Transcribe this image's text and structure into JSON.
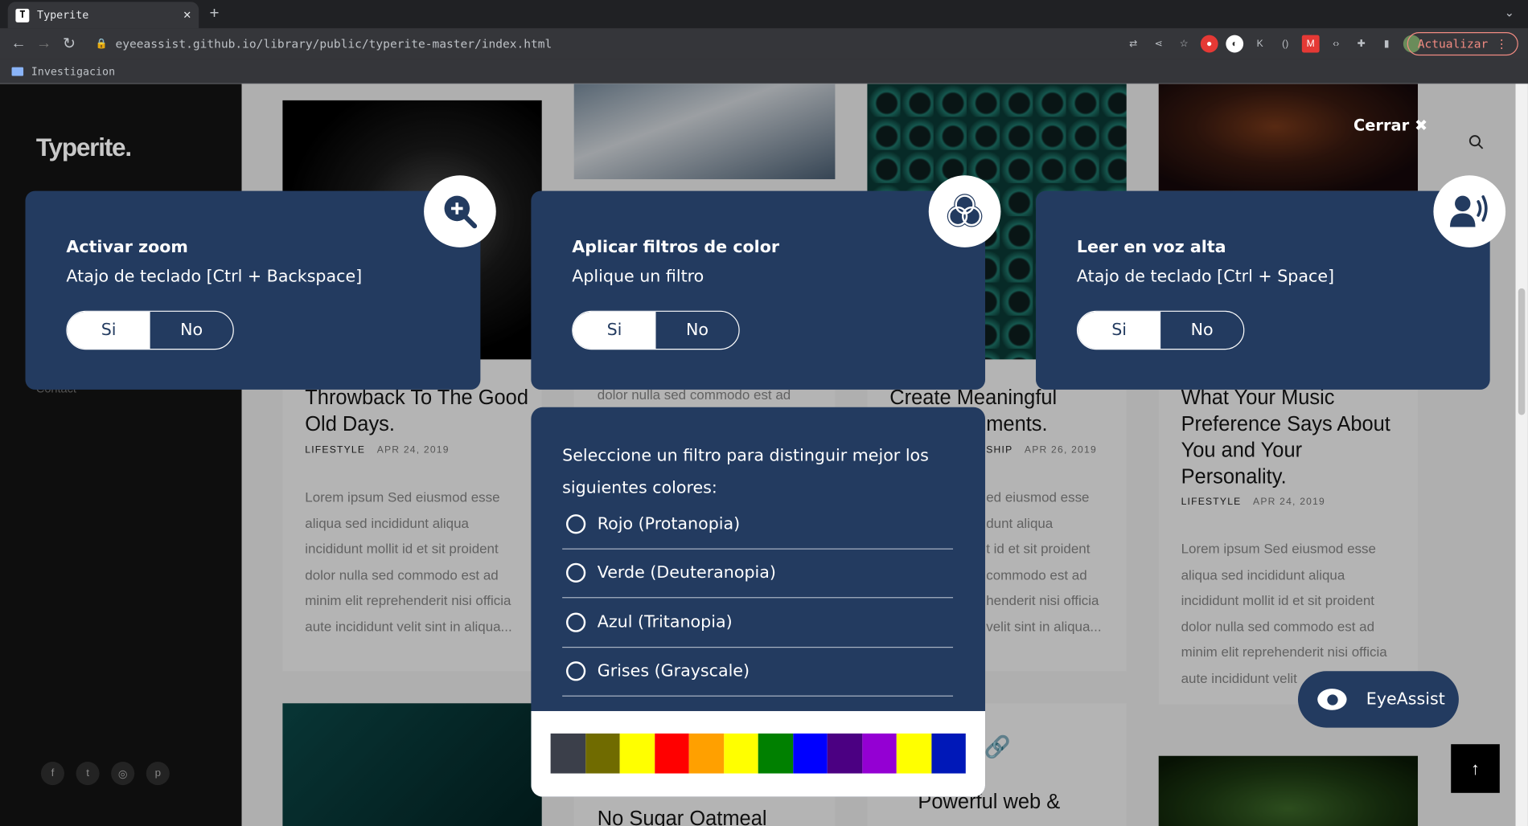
{
  "browser": {
    "tab_title": "Typerite",
    "tab_favicon": "T",
    "url": "eyeeassist.github.io/library/public/typerite-master/index.html",
    "bookmark": "Investigacion",
    "update_button": "Actualizar",
    "accent_update": "#f28b82"
  },
  "site": {
    "logo": "Typerite.",
    "sidebar_link": "Contact",
    "social_icons": [
      "facebook-icon",
      "twitter-icon",
      "dribbble-icon",
      "pinterest-icon"
    ],
    "posts": [
      {
        "title": "Throwback To The Good Old Days.",
        "category": "LIFESTYLE",
        "date": "APR 24, 2019",
        "excerpt": "Lorem ipsum Sed eiusmod esse aliqua sed incididunt aliqua incididunt mollit id et sit proident dolor nulla sed commodo est ad minim elit reprehenderit nisi officia aute incididunt velit sint in aliqua..."
      },
      {
        "excerpt_partial": "dolor nulla sed commodo est ad",
        "next_title": "No Sugar Oatmeal"
      },
      {
        "title_line1": "Create Meaningful",
        "title_line2": "ments.",
        "category": "SHIP",
        "date": "APR 26, 2019",
        "excerpt_lines": [
          "ed eiusmod esse",
          "dunt aliqua",
          "t id et sit proident",
          "commodo est ad",
          "henderit nisi officia",
          "velit sint in aliqua..."
        ],
        "next_title": "Powerful web &"
      },
      {
        "title": "What Your Music Preference Says About You and Your Personality.",
        "category": "LIFESTYLE",
        "date": "APR 24, 2019",
        "excerpt": "Lorem ipsum Sed eiusmod esse aliqua sed incididunt aliqua incididunt mollit id et sit proident dolor nulla sed commodo est ad minim elit reprehenderit nisi officia aute incididunt velit"
      }
    ]
  },
  "eyeassist": {
    "close_label": "Cerrar",
    "panels": [
      {
        "title": "Activar zoom",
        "subtitle": "Atajo de teclado [Ctrl + Backspace]",
        "yes": "Si",
        "no": "No",
        "icon": "zoom-in-icon"
      },
      {
        "title": "Aplicar filtros de color",
        "subtitle": "Aplique un filtro",
        "yes": "Si",
        "no": "No",
        "icon": "color-filter-icon"
      },
      {
        "title": "Leer en voz alta",
        "subtitle": "Atajo de teclado [Ctrl + Space]",
        "yes": "Si",
        "no": "No",
        "icon": "speaker-icon"
      }
    ],
    "filter": {
      "intro": "Seleccione un filtro para distinguir mejor los siguientes colores:",
      "options": [
        "Rojo (Protanopia)",
        "Verde (Deuteranopia)",
        "Azul (Tritanopia)",
        "Grises (Grayscale)"
      ],
      "swatches": [
        "#3b3f4a",
        "#706b00",
        "#ffff00",
        "#ff0000",
        "#ffa000",
        "#ffff00",
        "#008000",
        "#0000ff",
        "#4b0082",
        "#9400d3",
        "#ffff00",
        "#0018b8"
      ]
    },
    "launcher_label": "EyeAssist",
    "panel_color": "#233b60"
  }
}
